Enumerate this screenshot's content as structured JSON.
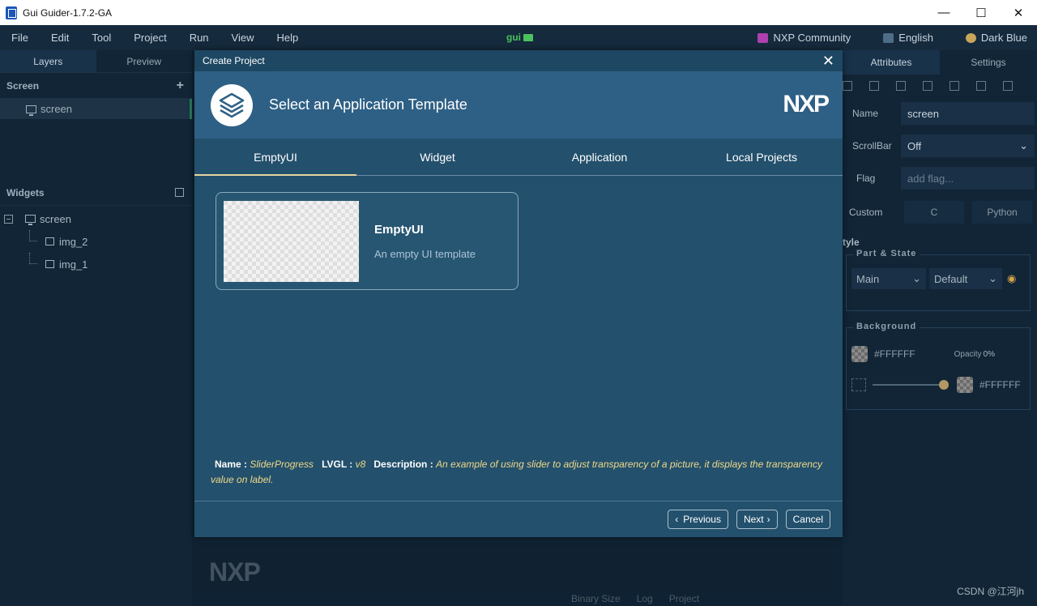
{
  "window": {
    "title": "Gui Guider-1.7.2-GA",
    "controls": [
      "—",
      "☐",
      "✕"
    ]
  },
  "menubar": {
    "items": [
      "File",
      "Edit",
      "Tool",
      "Project",
      "Run",
      "View",
      "Help"
    ],
    "project_name": "gui",
    "community": "NXP Community",
    "language": "English",
    "theme": "Dark Blue"
  },
  "left_panel": {
    "tabs": [
      "Layers",
      "Preview"
    ],
    "screen_section": "Screen",
    "screen_item": "screen",
    "widgets_section": "Widgets",
    "tree": {
      "root": "screen",
      "children": [
        "img_2",
        "img_1"
      ]
    }
  },
  "right_panel": {
    "tabs": [
      "Attributes",
      "Settings"
    ],
    "name_label": "Name",
    "name_value": "screen",
    "scrollbar_label": "ScrollBar",
    "scrollbar_value": "Off",
    "flag_label": "Flag",
    "flag_placeholder": "add flag...",
    "custom_label": "Custom",
    "custom_c": "C",
    "custom_python": "Python",
    "style_label": "tyle",
    "part_state_label": "Part & State",
    "part_value": "Main",
    "state_value": "Default",
    "background_label": "Background",
    "bg_color": "#FFFFFF",
    "opacity_label": "Opacity",
    "opacity_value": "0%",
    "grad_color": "#FFFFFF"
  },
  "dialog": {
    "title": "Create Project",
    "heading": "Select an Application Template",
    "brand": "NXP",
    "tabs": [
      "EmptyUI",
      "Widget",
      "Application",
      "Local Projects"
    ],
    "active_tab": "EmptyUI",
    "template": {
      "title": "EmptyUI",
      "description": "An empty UI template"
    },
    "info": {
      "name_key": "Name :",
      "name_value": "SliderProgress",
      "lvgl_key": "LVGL :",
      "lvgl_value": "v8",
      "desc_key": "Description :",
      "desc_value": "An example of using slider to adjust transparency of a picture, it displays the transparency value on label."
    },
    "buttons": {
      "previous": "Previous",
      "next": "Next",
      "cancel": "Cancel"
    }
  },
  "canvas": {
    "logo": "NXP"
  },
  "bottom_tabs": [
    "Binary Size",
    "Log",
    "Project"
  ],
  "watermark": "CSDN @江河jh",
  "colors": {
    "accent": "#e8d5a0",
    "dialog_bg": "#23506c",
    "header_bg": "#2e6085",
    "value_yellow": "#f0d98a"
  }
}
